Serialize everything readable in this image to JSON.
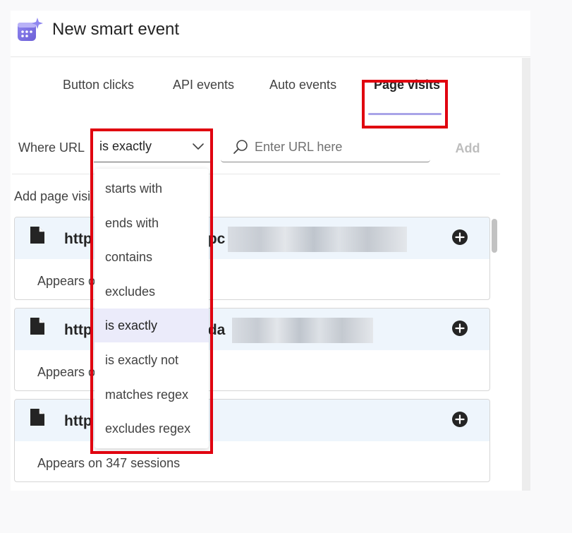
{
  "header": {
    "title": "New smart event",
    "app_icon": "calendar-sparkle-icon"
  },
  "tabs": [
    {
      "label": "Button clicks",
      "active": false
    },
    {
      "label": "API events",
      "active": false
    },
    {
      "label": "Auto events",
      "active": false
    },
    {
      "label": "Page visits",
      "active": true
    }
  ],
  "filter": {
    "where_label": "Where URL",
    "selected_operator": "is exactly",
    "search_placeholder": "Enter URL here",
    "add_label": "Add"
  },
  "dropdown_options": [
    {
      "label": "starts with",
      "selected": false
    },
    {
      "label": "ends with",
      "selected": false
    },
    {
      "label": "contains",
      "selected": false
    },
    {
      "label": "excludes",
      "selected": false
    },
    {
      "label": "is exactly",
      "selected": true
    },
    {
      "label": "is exactly not",
      "selected": false
    },
    {
      "label": "matches regex",
      "selected": false
    },
    {
      "label": "excludes regex",
      "selected": false
    }
  ],
  "section_label": "Add page visi",
  "pages": [
    {
      "url_prefix": "http",
      "url_suffix": "/pc",
      "sessions_text": "Appears o"
    },
    {
      "url_prefix": "http",
      "url_suffix": "/da",
      "sessions_text": "Appears o"
    },
    {
      "url_prefix": "http",
      "url_suffix": "",
      "sessions_text": "Appears on 347 sessions"
    }
  ],
  "colors": {
    "highlight": "#e0000f",
    "accent": "#7b6fe0",
    "card_header": "#eef5fc",
    "selected_option": "#ebebfa"
  }
}
